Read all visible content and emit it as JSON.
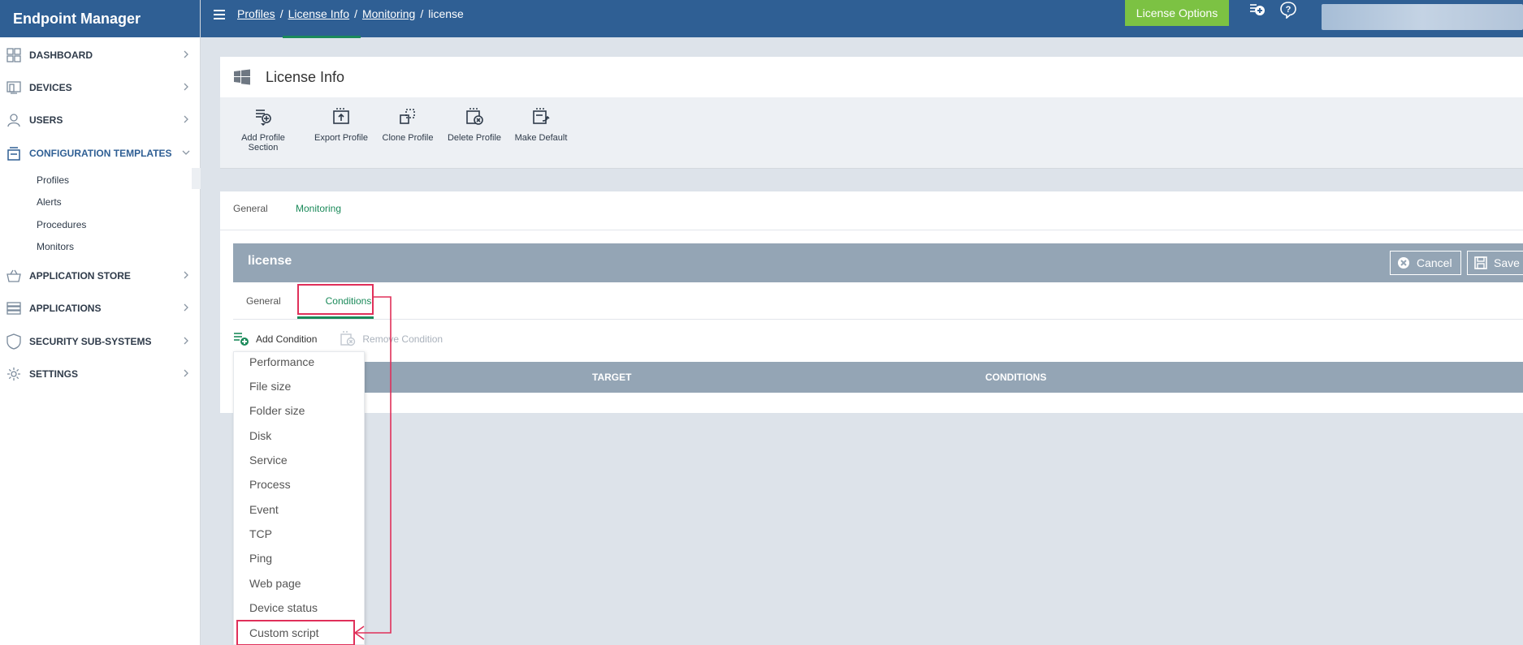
{
  "app": {
    "title": "Endpoint Manager"
  },
  "sidebar": {
    "items": [
      {
        "label": "DASHBOARD",
        "icon": "dashboard-icon"
      },
      {
        "label": "DEVICES",
        "icon": "devices-icon"
      },
      {
        "label": "USERS",
        "icon": "user-icon"
      },
      {
        "label": "CONFIGURATION TEMPLATES",
        "icon": "templates-icon",
        "expanded": true
      },
      {
        "label": "APPLICATION STORE",
        "icon": "basket-icon"
      },
      {
        "label": "APPLICATIONS",
        "icon": "applications-icon"
      },
      {
        "label": "SECURITY SUB-SYSTEMS",
        "icon": "shield-icon"
      },
      {
        "label": "SETTINGS",
        "icon": "gear-icon"
      }
    ],
    "subitems": [
      "Profiles",
      "Alerts",
      "Procedures",
      "Monitors"
    ]
  },
  "topbar": {
    "breadcrumbs": [
      "Profiles",
      "License Info",
      "Monitoring",
      "license"
    ],
    "license_button": "License Options",
    "icons": [
      "add-icon",
      "help-icon"
    ]
  },
  "page": {
    "title": "License Info",
    "toolbar": [
      {
        "label": "Add Profile Section",
        "icon": "add-section-icon"
      },
      {
        "label": "Export Profile",
        "icon": "export-icon"
      },
      {
        "label": "Clone Profile",
        "icon": "clone-icon"
      },
      {
        "label": "Delete Profile",
        "icon": "delete-icon"
      },
      {
        "label": "Make Default",
        "icon": "make-default-icon"
      }
    ],
    "tabs": [
      "General",
      "Monitoring"
    ],
    "active_tab": "Monitoring"
  },
  "monitor": {
    "title": "license",
    "cancel_label": "Cancel",
    "save_label": "Save",
    "tabs": [
      "General",
      "Conditions"
    ],
    "active_tab": "Conditions",
    "add_condition_label": "Add Condition",
    "remove_condition_label": "Remove Condition",
    "columns": [
      "TARGET",
      "CONDITIONS"
    ]
  },
  "condition_menu": {
    "items": [
      "Performance",
      "File size",
      "Folder size",
      "Disk",
      "Service",
      "Process",
      "Event",
      "TCP",
      "Ping",
      "Web page",
      "Device status",
      "Custom script"
    ],
    "highlighted": "Custom script"
  },
  "colors": {
    "brand": "#2f5f94",
    "accent_green": "#7cc243",
    "tab_green": "#1b8a5a",
    "header_gray": "#94a5b5",
    "annotation_red": "#e0305a"
  }
}
